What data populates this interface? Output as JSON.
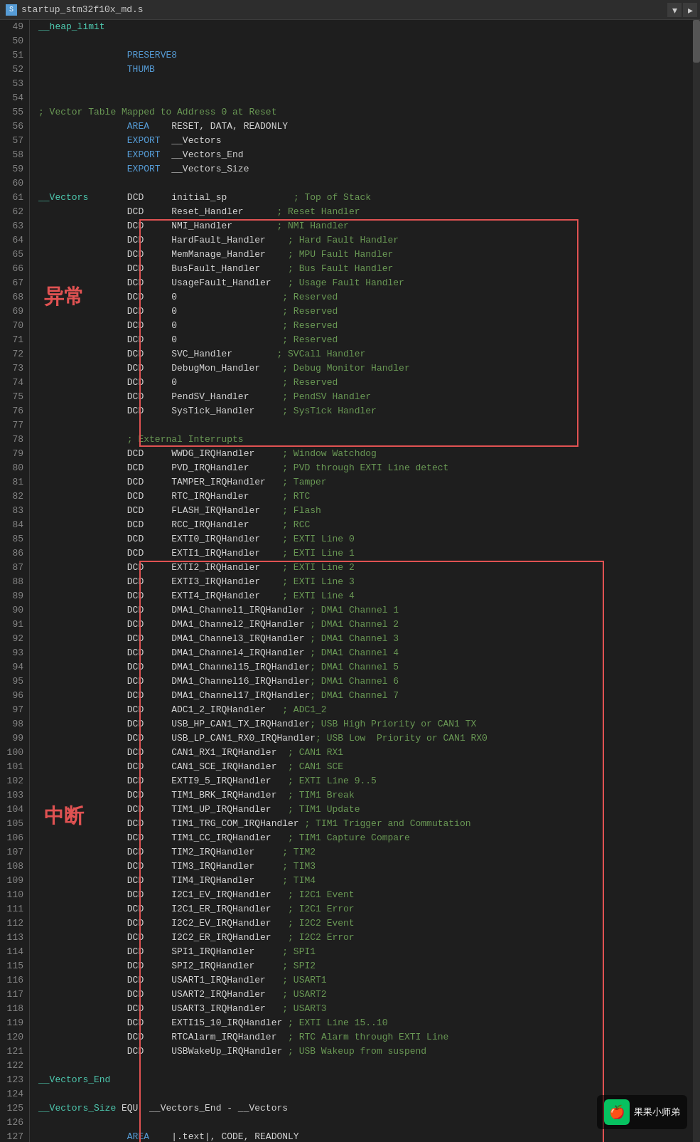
{
  "title": {
    "filename": "startup_stm32f10x_md.s",
    "icon_label": "S"
  },
  "editor": {
    "lines": [
      {
        "num": 49,
        "content": [
          {
            "t": "__heap_limit",
            "c": "c-label"
          }
        ]
      },
      {
        "num": 50,
        "content": []
      },
      {
        "num": 51,
        "content": [
          {
            "t": "                PRESERVE8",
            "c": "c-keyword"
          }
        ]
      },
      {
        "num": 52,
        "content": [
          {
            "t": "                THUMB",
            "c": "c-keyword"
          }
        ]
      },
      {
        "num": 53,
        "content": []
      },
      {
        "num": 54,
        "content": []
      },
      {
        "num": 55,
        "content": [
          {
            "t": "; Vector Table Mapped to Address 0 at Reset",
            "c": "c-comment"
          }
        ]
      },
      {
        "num": 56,
        "content": [
          {
            "t": "                AREA",
            "c": "c-keyword"
          },
          {
            "t": "    RESET, DATA, READONLY",
            "c": "c-plain"
          }
        ]
      },
      {
        "num": 57,
        "content": [
          {
            "t": "                EXPORT",
            "c": "c-keyword"
          },
          {
            "t": "  __Vectors",
            "c": "c-plain"
          }
        ]
      },
      {
        "num": 58,
        "content": [
          {
            "t": "                EXPORT",
            "c": "c-keyword"
          },
          {
            "t": "  __Vectors_End",
            "c": "c-plain"
          }
        ]
      },
      {
        "num": 59,
        "content": [
          {
            "t": "                EXPORT",
            "c": "c-keyword"
          },
          {
            "t": "  __Vectors_Size",
            "c": "c-plain"
          }
        ]
      },
      {
        "num": 60,
        "content": []
      },
      {
        "num": 61,
        "content": [
          {
            "t": "__Vectors",
            "c": "c-label"
          },
          {
            "t": "       DCD     initial_sp",
            "c": "c-plain"
          },
          {
            "t": "            ; Top of Stack",
            "c": "c-comment"
          }
        ]
      },
      {
        "num": 62,
        "content": [
          {
            "t": "                DCD     Reset_Handler",
            "c": "c-plain"
          },
          {
            "t": "      ; Reset Handler",
            "c": "c-comment"
          }
        ]
      },
      {
        "num": 63,
        "content": [
          {
            "t": "                DCD     NMI_Handler",
            "c": "c-plain"
          },
          {
            "t": "        ; NMI Handler",
            "c": "c-comment"
          }
        ]
      },
      {
        "num": 64,
        "content": [
          {
            "t": "                DCD     HardFault_Handler",
            "c": "c-plain"
          },
          {
            "t": "    ; Hard Fault Handler",
            "c": "c-comment"
          }
        ]
      },
      {
        "num": 65,
        "content": [
          {
            "t": "                DCD     MemManage_Handler",
            "c": "c-plain"
          },
          {
            "t": "    ; MPU Fault Handler",
            "c": "c-comment"
          }
        ]
      },
      {
        "num": 66,
        "content": [
          {
            "t": "                DCD     BusFault_Handler",
            "c": "c-plain"
          },
          {
            "t": "     ; Bus Fault Handler",
            "c": "c-comment"
          }
        ]
      },
      {
        "num": 67,
        "content": [
          {
            "t": "                DCD     UsageFault_Handler",
            "c": "c-plain"
          },
          {
            "t": "   ; Usage Fault Handler",
            "c": "c-comment"
          }
        ]
      },
      {
        "num": 68,
        "content": [
          {
            "t": "                DCD     0",
            "c": "c-plain"
          },
          {
            "t": "                   ; Reserved",
            "c": "c-comment"
          }
        ]
      },
      {
        "num": 69,
        "content": [
          {
            "t": "                DCD     0",
            "c": "c-plain"
          },
          {
            "t": "                   ; Reserved",
            "c": "c-comment"
          }
        ]
      },
      {
        "num": 70,
        "content": [
          {
            "t": "                DCD     0",
            "c": "c-plain"
          },
          {
            "t": "                   ; Reserved",
            "c": "c-comment"
          }
        ]
      },
      {
        "num": 71,
        "content": [
          {
            "t": "                DCD     0",
            "c": "c-plain"
          },
          {
            "t": "                   ; Reserved",
            "c": "c-comment"
          }
        ]
      },
      {
        "num": 72,
        "content": [
          {
            "t": "                DCD     SVC_Handler",
            "c": "c-plain"
          },
          {
            "t": "        ; SVCall Handler",
            "c": "c-comment"
          }
        ]
      },
      {
        "num": 73,
        "content": [
          {
            "t": "                DCD     DebugMon_Handler",
            "c": "c-plain"
          },
          {
            "t": "    ; Debug Monitor Handler",
            "c": "c-comment"
          }
        ]
      },
      {
        "num": 74,
        "content": [
          {
            "t": "                DCD     0",
            "c": "c-plain"
          },
          {
            "t": "                   ; Reserved",
            "c": "c-comment"
          }
        ]
      },
      {
        "num": 75,
        "content": [
          {
            "t": "                DCD     PendSV_Handler",
            "c": "c-plain"
          },
          {
            "t": "      ; PendSV Handler",
            "c": "c-comment"
          }
        ]
      },
      {
        "num": 76,
        "content": [
          {
            "t": "                DCD     SysTick_Handler",
            "c": "c-plain"
          },
          {
            "t": "     ; SysTick Handler",
            "c": "c-comment"
          }
        ]
      },
      {
        "num": 77,
        "content": []
      },
      {
        "num": 78,
        "content": [
          {
            "t": "                ; External Interrupts",
            "c": "c-comment"
          }
        ]
      },
      {
        "num": 79,
        "content": [
          {
            "t": "                DCD     WWDG_IRQHandler",
            "c": "c-plain"
          },
          {
            "t": "     ; Window Watchdog",
            "c": "c-comment"
          }
        ]
      },
      {
        "num": 80,
        "content": [
          {
            "t": "                DCD     PVD_IRQHandler",
            "c": "c-plain"
          },
          {
            "t": "      ; PVD through EXTI Line detect",
            "c": "c-comment"
          }
        ]
      },
      {
        "num": 81,
        "content": [
          {
            "t": "                DCD     TAMPER_IRQHandler",
            "c": "c-plain"
          },
          {
            "t": "   ; Tamper",
            "c": "c-comment"
          }
        ]
      },
      {
        "num": 82,
        "content": [
          {
            "t": "                DCD     RTC_IRQHandler",
            "c": "c-plain"
          },
          {
            "t": "      ; RTC",
            "c": "c-comment"
          }
        ]
      },
      {
        "num": 83,
        "content": [
          {
            "t": "                DCD     FLASH_IRQHandler",
            "c": "c-plain"
          },
          {
            "t": "    ; Flash",
            "c": "c-comment"
          }
        ]
      },
      {
        "num": 84,
        "content": [
          {
            "t": "                DCD     RCC_IRQHandler",
            "c": "c-plain"
          },
          {
            "t": "      ; RCC",
            "c": "c-comment"
          }
        ]
      },
      {
        "num": 85,
        "content": [
          {
            "t": "                DCD     EXTI0_IRQHandler",
            "c": "c-plain"
          },
          {
            "t": "    ; EXTI Line 0",
            "c": "c-comment"
          }
        ]
      },
      {
        "num": 86,
        "content": [
          {
            "t": "                DCD     EXTI1_IRQHandler",
            "c": "c-plain"
          },
          {
            "t": "    ; EXTI Line 1",
            "c": "c-comment"
          }
        ]
      },
      {
        "num": 87,
        "content": [
          {
            "t": "                DCD     EXTI2_IRQHandler",
            "c": "c-plain"
          },
          {
            "t": "    ; EXTI Line 2",
            "c": "c-comment"
          }
        ]
      },
      {
        "num": 88,
        "content": [
          {
            "t": "                DCD     EXTI3_IRQHandler",
            "c": "c-plain"
          },
          {
            "t": "    ; EXTI Line 3",
            "c": "c-comment"
          }
        ]
      },
      {
        "num": 89,
        "content": [
          {
            "t": "                DCD     EXTI4_IRQHandler",
            "c": "c-plain"
          },
          {
            "t": "    ; EXTI Line 4",
            "c": "c-comment"
          }
        ]
      },
      {
        "num": 90,
        "content": [
          {
            "t": "                DCD     DMA1_Channel1_IRQHandler",
            "c": "c-plain"
          },
          {
            "t": " ; DMA1 Channel 1",
            "c": "c-comment"
          }
        ]
      },
      {
        "num": 91,
        "content": [
          {
            "t": "                DCD     DMA1_Channel2_IRQHandler",
            "c": "c-plain"
          },
          {
            "t": " ; DMA1 Channel 2",
            "c": "c-comment"
          }
        ]
      },
      {
        "num": 92,
        "content": [
          {
            "t": "                DCD     DMA1_Channel3_IRQHandler",
            "c": "c-plain"
          },
          {
            "t": " ; DMA1 Channel 3",
            "c": "c-comment"
          }
        ]
      },
      {
        "num": 93,
        "content": [
          {
            "t": "                DCD     DMA1_Channel4_IRQHandler",
            "c": "c-plain"
          },
          {
            "t": " ; DMA1 Channel 4",
            "c": "c-comment"
          }
        ]
      },
      {
        "num": 94,
        "content": [
          {
            "t": "                DCD     DMA1_Channel15_IRQHandler",
            "c": "c-plain"
          },
          {
            "t": "; DMA1 Channel 5",
            "c": "c-comment"
          }
        ]
      },
      {
        "num": 95,
        "content": [
          {
            "t": "                DCD     DMA1_Channel16_IRQHandler",
            "c": "c-plain"
          },
          {
            "t": "; DMA1 Channel 6",
            "c": "c-comment"
          }
        ]
      },
      {
        "num": 96,
        "content": [
          {
            "t": "                DCD     DMA1_Channel17_IRQHandler",
            "c": "c-plain"
          },
          {
            "t": "; DMA1 Channel 7",
            "c": "c-comment"
          }
        ]
      },
      {
        "num": 97,
        "content": [
          {
            "t": "                DCD     ADC1_2_IRQHandler",
            "c": "c-plain"
          },
          {
            "t": "   ; ADC1_2",
            "c": "c-comment"
          }
        ]
      },
      {
        "num": 98,
        "content": [
          {
            "t": "                DCD     USB_HP_CAN1_TX_IRQHandler",
            "c": "c-plain"
          },
          {
            "t": "; USB High Priority or CAN1 TX",
            "c": "c-comment"
          }
        ]
      },
      {
        "num": 99,
        "content": [
          {
            "t": "                DCD     USB_LP_CAN1_RX0_IRQHandler",
            "c": "c-plain"
          },
          {
            "t": "; USB Low  Priority or CAN1 RX0",
            "c": "c-comment"
          }
        ]
      },
      {
        "num": 100,
        "content": [
          {
            "t": "                DCD     CAN1_RX1_IRQHandler",
            "c": "c-plain"
          },
          {
            "t": "  ; CAN1 RX1",
            "c": "c-comment"
          }
        ]
      },
      {
        "num": 101,
        "content": [
          {
            "t": "                DCD     CAN1_SCE_IRQHandler",
            "c": "c-plain"
          },
          {
            "t": "  ; CAN1 SCE",
            "c": "c-comment"
          }
        ]
      },
      {
        "num": 102,
        "content": [
          {
            "t": "                DCD     EXTI9_5_IRQHandler",
            "c": "c-plain"
          },
          {
            "t": "   ; EXTI Line 9..5",
            "c": "c-comment"
          }
        ]
      },
      {
        "num": 103,
        "content": [
          {
            "t": "                DCD     TIM1_BRK_IRQHandler",
            "c": "c-plain"
          },
          {
            "t": "  ; TIM1 Break",
            "c": "c-comment"
          }
        ]
      },
      {
        "num": 104,
        "content": [
          {
            "t": "                DCD     TIM1_UP_IRQHandler",
            "c": "c-plain"
          },
          {
            "t": "   ; TIM1 Update",
            "c": "c-comment"
          }
        ]
      },
      {
        "num": 105,
        "content": [
          {
            "t": "                DCD     TIM1_TRG_COM_IRQHandler",
            "c": "c-plain"
          },
          {
            "t": " ; TIM1 Trigger and Commutation",
            "c": "c-comment"
          }
        ]
      },
      {
        "num": 106,
        "content": [
          {
            "t": "                DCD     TIM1_CC_IRQHandler",
            "c": "c-plain"
          },
          {
            "t": "   ; TIM1 Capture Compare",
            "c": "c-comment"
          }
        ]
      },
      {
        "num": 107,
        "content": [
          {
            "t": "                DCD     TIM2_IRQHandler",
            "c": "c-plain"
          },
          {
            "t": "     ; TIM2",
            "c": "c-comment"
          }
        ]
      },
      {
        "num": 108,
        "content": [
          {
            "t": "                DCD     TIM3_IRQHandler",
            "c": "c-plain"
          },
          {
            "t": "     ; TIM3",
            "c": "c-comment"
          }
        ]
      },
      {
        "num": 109,
        "content": [
          {
            "t": "                DCD     TIM4_IRQHandler",
            "c": "c-plain"
          },
          {
            "t": "     ; TIM4",
            "c": "c-comment"
          }
        ]
      },
      {
        "num": 110,
        "content": [
          {
            "t": "                DCD     I2C1_EV_IRQHandler",
            "c": "c-plain"
          },
          {
            "t": "   ; I2C1 Event",
            "c": "c-comment"
          }
        ]
      },
      {
        "num": 111,
        "content": [
          {
            "t": "                DCD     I2C1_ER_IRQHandler",
            "c": "c-plain"
          },
          {
            "t": "   ; I2C1 Error",
            "c": "c-comment"
          }
        ]
      },
      {
        "num": 112,
        "content": [
          {
            "t": "                DCD     I2C2_EV_IRQHandler",
            "c": "c-plain"
          },
          {
            "t": "   ; I2C2 Event",
            "c": "c-comment"
          }
        ]
      },
      {
        "num": 113,
        "content": [
          {
            "t": "                DCD     I2C2_ER_IRQHandler",
            "c": "c-plain"
          },
          {
            "t": "   ; I2C2 Error",
            "c": "c-comment"
          }
        ]
      },
      {
        "num": 114,
        "content": [
          {
            "t": "                DCD     SPI1_IRQHandler",
            "c": "c-plain"
          },
          {
            "t": "     ; SPI1",
            "c": "c-comment"
          }
        ]
      },
      {
        "num": 115,
        "content": [
          {
            "t": "                DCD     SPI2_IRQHandler",
            "c": "c-plain"
          },
          {
            "t": "     ; SPI2",
            "c": "c-comment"
          }
        ]
      },
      {
        "num": 116,
        "content": [
          {
            "t": "                DCD     USART1_IRQHandler",
            "c": "c-plain"
          },
          {
            "t": "   ; USART1",
            "c": "c-comment"
          }
        ]
      },
      {
        "num": 117,
        "content": [
          {
            "t": "                DCD     USART2_IRQHandler",
            "c": "c-plain"
          },
          {
            "t": "   ; USART2",
            "c": "c-comment"
          }
        ]
      },
      {
        "num": 118,
        "content": [
          {
            "t": "                DCD     USART3_IRQHandler",
            "c": "c-plain"
          },
          {
            "t": "   ; USART3",
            "c": "c-comment"
          }
        ]
      },
      {
        "num": 119,
        "content": [
          {
            "t": "                DCD     EXTI15_10_IRQHandler",
            "c": "c-plain"
          },
          {
            "t": " ; EXTI Line 15..10",
            "c": "c-comment"
          }
        ]
      },
      {
        "num": 120,
        "content": [
          {
            "t": "                DCD     RTCAlarm_IRQHandler",
            "c": "c-plain"
          },
          {
            "t": "  ; RTC Alarm through EXTI Line",
            "c": "c-comment"
          }
        ]
      },
      {
        "num": 121,
        "content": [
          {
            "t": "                DCD     USBWakeUp_IRQHandler",
            "c": "c-plain"
          },
          {
            "t": " ; USB Wakeup from suspend",
            "c": "c-comment"
          }
        ]
      },
      {
        "num": 122,
        "content": []
      },
      {
        "num": 123,
        "content": [
          {
            "t": "__Vectors_End",
            "c": "c-label"
          }
        ]
      },
      {
        "num": 124,
        "content": []
      },
      {
        "num": 125,
        "content": [
          {
            "t": "__Vectors_Size",
            "c": "c-label"
          },
          {
            "t": " EQU  __Vectors_End - __Vectors",
            "c": "c-plain"
          }
        ]
      },
      {
        "num": 126,
        "content": []
      },
      {
        "num": 127,
        "content": [
          {
            "t": "                AREA",
            "c": "c-keyword"
          },
          {
            "t": "    |.text|, CODE, READONLY",
            "c": "c-plain"
          }
        ]
      }
    ]
  },
  "labels": {
    "exception": "异常",
    "interrupt": "中断"
  },
  "watermark": {
    "text": "果果小师弟",
    "icon": "🍎"
  }
}
